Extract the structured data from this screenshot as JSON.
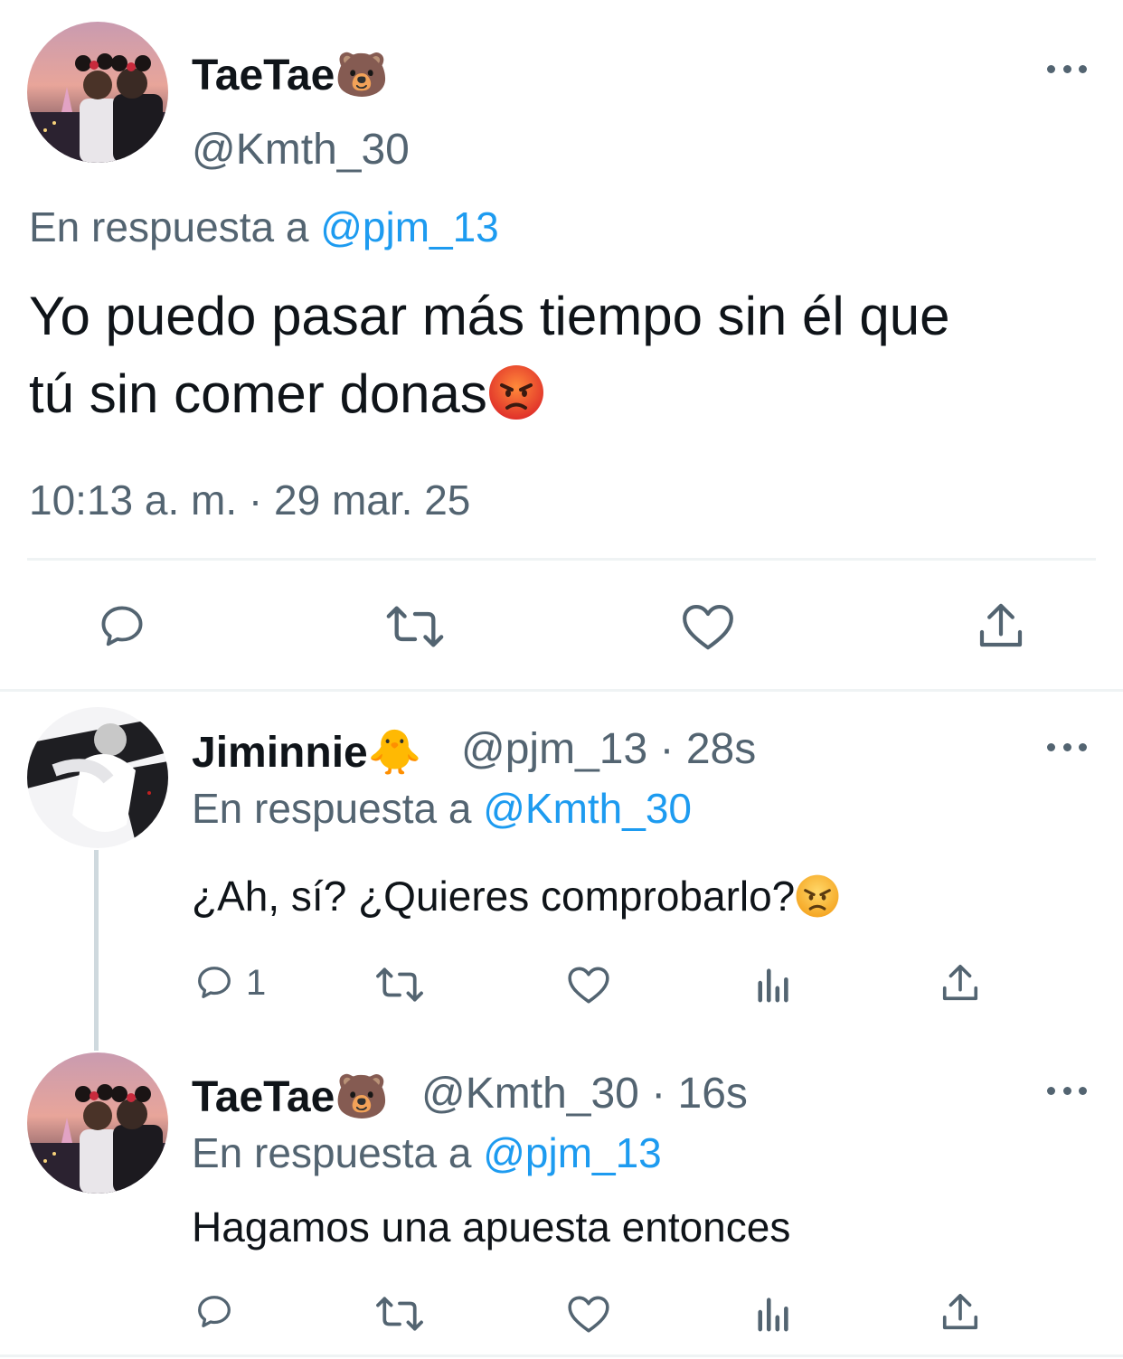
{
  "main_tweet": {
    "display_name": "TaeTae",
    "name_emoji": "🐻",
    "handle": "@Kmth_30",
    "reply_prefix": "En respuesta a",
    "reply_mention": "@pjm_13",
    "text_line1": "Yo puedo pasar más tiempo sin él que",
    "text_line2": "tú sin comer donas",
    "text_emoji": "😡",
    "timestamp": "10:13 a. m. · 29 mar. 25"
  },
  "replies": [
    {
      "display_name": "Jiminnie",
      "name_emoji": "🐥",
      "handle": "@pjm_13",
      "separator": "·",
      "time": "28s",
      "reply_prefix": "En respuesta a",
      "reply_mention": "@Kmth_30",
      "text": "¿Ah, sí? ¿Quieres comprobarlo?",
      "text_emoji": "😠",
      "reply_count": "1"
    },
    {
      "display_name": "TaeTae",
      "name_emoji": "🐻",
      "handle": "@Kmth_30",
      "separator": "·",
      "time": "16s",
      "reply_prefix": "En respuesta a",
      "reply_mention": "@pjm_13",
      "text": "Hagamos una apuesta entonces",
      "reply_count": ""
    }
  ],
  "icons": {
    "reply": "speech-bubble-icon",
    "retweet": "retweet-icon",
    "like": "heart-icon",
    "views": "bar-chart-icon",
    "share": "share-upload-icon",
    "more": "more-dots-icon"
  },
  "colors": {
    "link": "#1d9bf0",
    "secondary_text": "#536471",
    "primary_text": "#0f1419",
    "divider": "#eff3f4",
    "thread_line": "#cfd9de"
  }
}
